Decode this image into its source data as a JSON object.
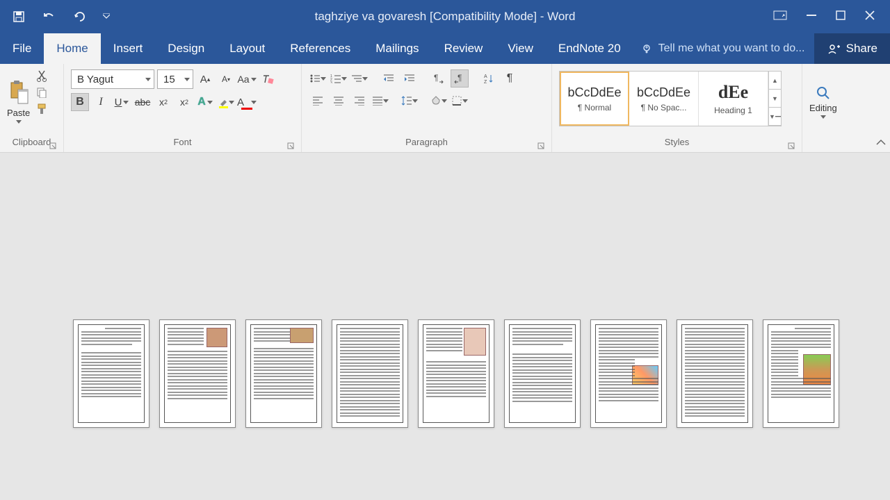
{
  "titlebar": {
    "title": "taghziye va govaresh [Compatibility Mode] - Word"
  },
  "menu": {
    "file": "File",
    "home": "Home",
    "insert": "Insert",
    "design": "Design",
    "layout": "Layout",
    "references": "References",
    "mailings": "Mailings",
    "review": "Review",
    "view": "View",
    "endnote": "EndNote 20",
    "tellme": "Tell me what you want to do...",
    "share": "Share"
  },
  "ribbon": {
    "clipboard": {
      "label": "Clipboard",
      "paste": "Paste"
    },
    "font": {
      "label": "Font",
      "name": "B Yagut",
      "size": "15"
    },
    "paragraph": {
      "label": "Paragraph"
    },
    "styles": {
      "label": "Styles",
      "items": [
        {
          "preview": "bCcDdEe",
          "name": "¶ Normal"
        },
        {
          "preview": "bCcDdEe",
          "name": "¶ No Spac..."
        },
        {
          "preview": "dEe",
          "name": "Heading 1"
        }
      ]
    },
    "editing": {
      "label": "Editing"
    }
  }
}
